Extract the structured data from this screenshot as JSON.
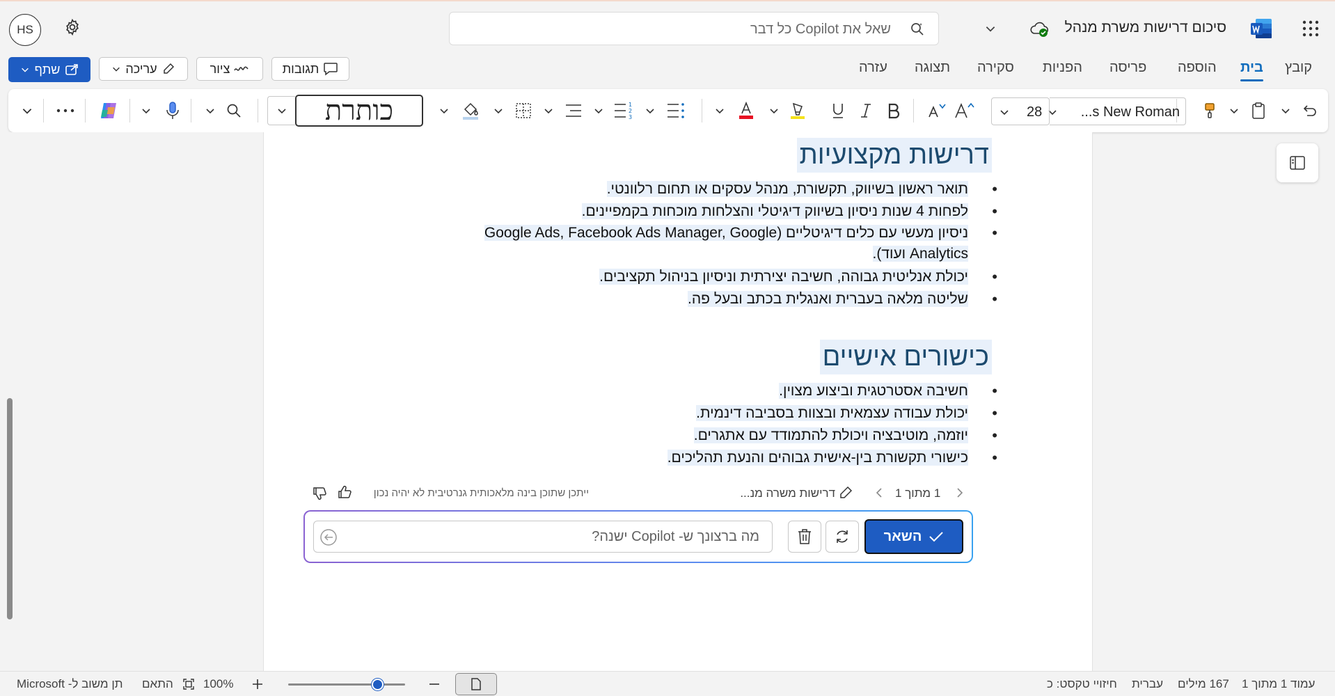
{
  "titlebar": {
    "avatar_initials": "HS",
    "search_placeholder": "שאל את Copilot כל דבר",
    "doc_title": "סיכום דרישות משרת מנהל"
  },
  "tabs": [
    {
      "label": "קובץ"
    },
    {
      "label": "בית"
    },
    {
      "label": "הוספה"
    },
    {
      "label": "פריסה"
    },
    {
      "label": "הפניות"
    },
    {
      "label": "סקירה"
    },
    {
      "label": "תצוגה"
    },
    {
      "label": "עזרה"
    }
  ],
  "actions": {
    "comments": "תגובות",
    "draw": "ציור",
    "editing": "עריכה",
    "share": "שתף"
  },
  "ribbon": {
    "font_name": "...s New Roman",
    "font_size": "28",
    "style": "כותרת",
    "brand_color": "#1e5cc2",
    "font_color_bar": "#e81123",
    "highlight_bar": "#f5e21b"
  },
  "document": {
    "sections": [
      {
        "heading": "דרישות מקצועיות",
        "items": [
          "תואר ראשון בשיווק, תקשורת, מנהל עסקים או תחום רלוונטי.",
          "לפחות 4 שנות ניסיון בשיווק דיגיטלי והצלחות מוכחות בקמפיינים.",
          "ניסיון מעשי עם כלים דיגיטליים (Google Ads, Facebook Ads Manager, Google Analytics ועוד).",
          "יכולת אנליטית גבוהה, חשיבה יצירתית וניסיון בניהול תקציבים.",
          "שליטה מלאה בעברית ואנגלית בכתב ובעל פה."
        ]
      },
      {
        "heading": "כישורים אישיים",
        "items": [
          "חשיבה אסטרטגית וביצוע מצוין.",
          "יכולת עבודה עצמאית ובצוות בסביבה דינמית.",
          "יוזמה, מוטיבציה ויכולת להתמודד עם אתגרים.",
          "כישורי תקשורת בין-אישית גבוהים והנעת תהליכים."
        ]
      }
    ]
  },
  "copilot": {
    "pager": "1 מתוך 1",
    "draft_title": "דרישות משרה מנ...",
    "disclaimer": "ייתכן שתוכן בינה מלאכותית גנרטיבית לא יהיה נכון",
    "input_placeholder": "מה ברצונך ש- Copilot ישנה?",
    "keep_label": "השאר"
  },
  "status": {
    "page": "עמוד 1 מתוך 1",
    "words": "167 מילים",
    "language": "עברית",
    "predictions": "חיזויי טקסט: כ",
    "zoom": "100%",
    "fit": "התאם",
    "feedback": "תן משוב ל- Microsoft"
  }
}
